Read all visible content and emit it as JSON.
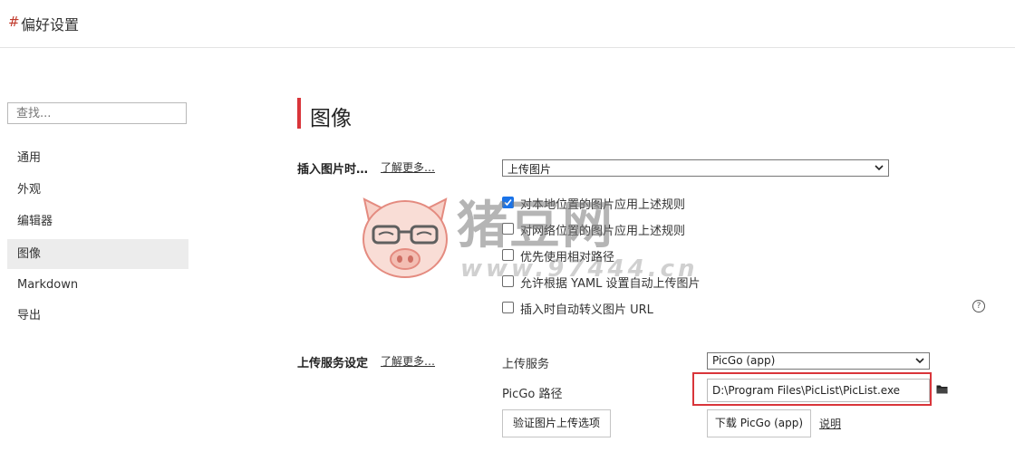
{
  "window": {
    "hash": "#",
    "title": "偏好设置"
  },
  "sidebar": {
    "search_placeholder": "查找...",
    "items": [
      {
        "label": "通用"
      },
      {
        "label": "外观"
      },
      {
        "label": "编辑器"
      },
      {
        "label": "图像",
        "active": true
      },
      {
        "label": "Markdown"
      },
      {
        "label": "导出"
      }
    ]
  },
  "main": {
    "section_title": "图像",
    "insert_image": {
      "label": "插入图片时…",
      "learn_more": "了解更多…",
      "action_select": "上传图片",
      "options": [
        {
          "label": "对本地位置的图片应用上述规则",
          "checked": true
        },
        {
          "label": "对网络位置的图片应用上述规则",
          "checked": false
        },
        {
          "label": "优先使用相对路径",
          "checked": false
        },
        {
          "label": "允许根据 YAML 设置自动上传图片",
          "checked": false
        },
        {
          "label": "插入时自动转义图片 URL",
          "checked": false
        }
      ],
      "help_icon": "?"
    },
    "upload_service": {
      "label": "上传服务设定",
      "learn_more": "了解更多…",
      "service_label": "上传服务",
      "service_value": "PicGo (app)",
      "path_label": "PicGo 路径",
      "path_value": "D:\\Program Files\\PicList\\PicList.exe",
      "verify_button": "验证图片上传选项",
      "download_button": "下载 PicGo (app)",
      "explain_link": "说明"
    }
  },
  "watermark": {
    "text": "猪豆网",
    "url": "www.97444.cn"
  },
  "colors": {
    "accent": "#d9353a",
    "checkbox": "#1a73e8",
    "active_nav": "#ececec"
  }
}
